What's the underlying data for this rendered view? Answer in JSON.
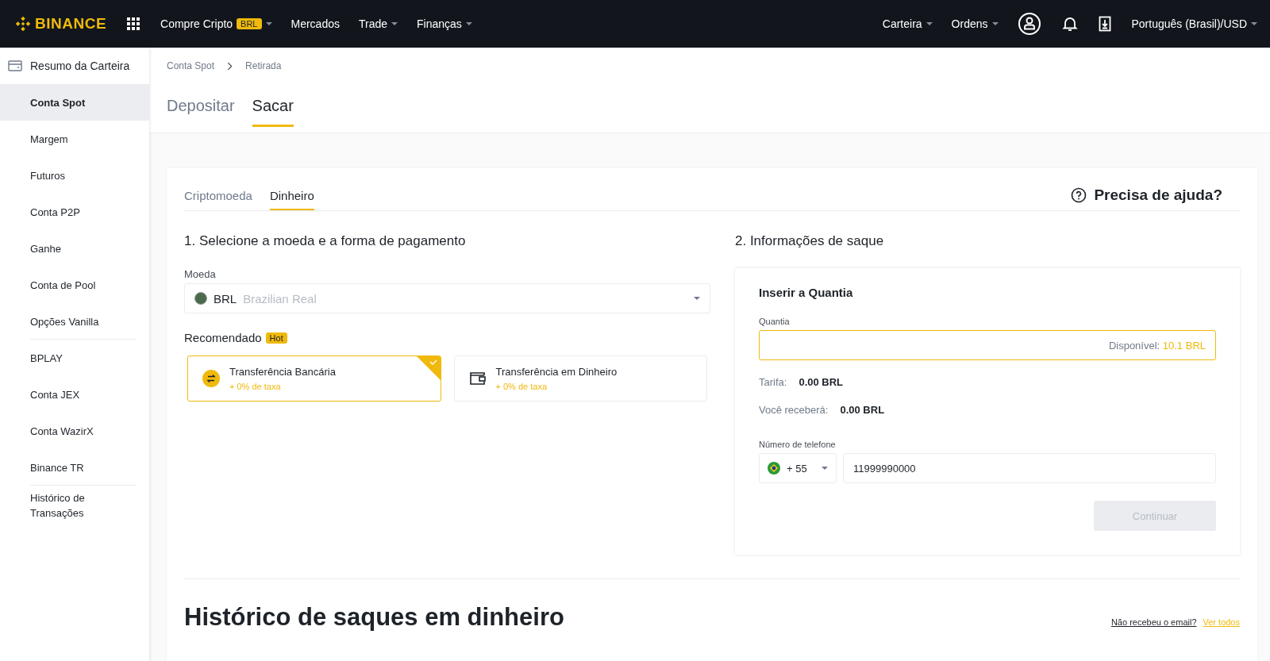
{
  "header": {
    "logo": "BINANCE",
    "nav": [
      {
        "label": "Compre Cripto",
        "badge": "BRL",
        "caret": true
      },
      {
        "label": "Mercados",
        "caret": false
      },
      {
        "label": "Trade",
        "caret": true
      },
      {
        "label": "Finanças",
        "caret": true
      }
    ],
    "right_nav": [
      {
        "label": "Carteira",
        "caret": true
      },
      {
        "label": "Ordens",
        "caret": true
      }
    ],
    "language": "Português (Brasil)/USD"
  },
  "sidebar": {
    "header": "Resumo da Carteira",
    "items": [
      {
        "label": "Conta Spot",
        "selected": true,
        "divider_after": false
      },
      {
        "label": "Margem",
        "selected": false,
        "divider_after": false
      },
      {
        "label": "Futuros",
        "selected": false,
        "divider_after": false
      },
      {
        "label": "Conta P2P",
        "selected": false,
        "divider_after": false
      },
      {
        "label": "Ganhe",
        "selected": false,
        "divider_after": false
      },
      {
        "label": "Conta de Pool",
        "selected": false,
        "divider_after": false
      },
      {
        "label": "Opções Vanilla",
        "selected": false,
        "divider_after": true
      },
      {
        "label": "BPLAY",
        "selected": false,
        "divider_after": false
      },
      {
        "label": "Conta JEX",
        "selected": false,
        "divider_after": false
      },
      {
        "label": "Conta WazirX",
        "selected": false,
        "divider_after": false
      },
      {
        "label": "Binance TR",
        "selected": false,
        "divider_after": true
      },
      {
        "label": "Histórico de Transações",
        "selected": false,
        "divider_after": false
      }
    ]
  },
  "breadcrumb": [
    "Conta Spot",
    "Retirada"
  ],
  "tabs": [
    {
      "label": "Depositar",
      "selected": false
    },
    {
      "label": "Sacar",
      "selected": true
    }
  ],
  "subtabs": [
    {
      "label": "Criptomoeda",
      "selected": false
    },
    {
      "label": "Dinheiro",
      "selected": true
    }
  ],
  "help": "Precisa de ajuda?",
  "step1": {
    "title": "1. Selecione a moeda e a forma de pagamento",
    "currency_label": "Moeda",
    "currency_code": "BRL",
    "currency_name": "Brazilian Real",
    "recommended": "Recomendado",
    "hot": "Hot",
    "methods": [
      {
        "kind": "bank",
        "name": "Transferência Bancária",
        "fee": "+ 0% de taxa",
        "selected": true
      },
      {
        "kind": "cash",
        "name": "Transferência em Dinheiro",
        "fee": "+ 0% de taxa",
        "selected": false
      }
    ]
  },
  "step2": {
    "title": "2. Informações de saque",
    "card_title": "Inserir a Quantia",
    "amount_label": "Quantia",
    "available_label": "Disponível:",
    "available_value": "10.1 BRL",
    "fee_label": "Tarifa:",
    "fee_value": "0.00 BRL",
    "receive_label": "Você receberá:",
    "receive_value": "0.00 BRL",
    "phone_label": "Número de telefone",
    "country_code": "+ 55",
    "phone": "11999990000",
    "button": "Continuar",
    "button_disabled": true
  },
  "history": {
    "title": "Histórico de saques em dinheiro",
    "email_question": "Não recebeu o email?",
    "view_all": "Ver todos"
  }
}
